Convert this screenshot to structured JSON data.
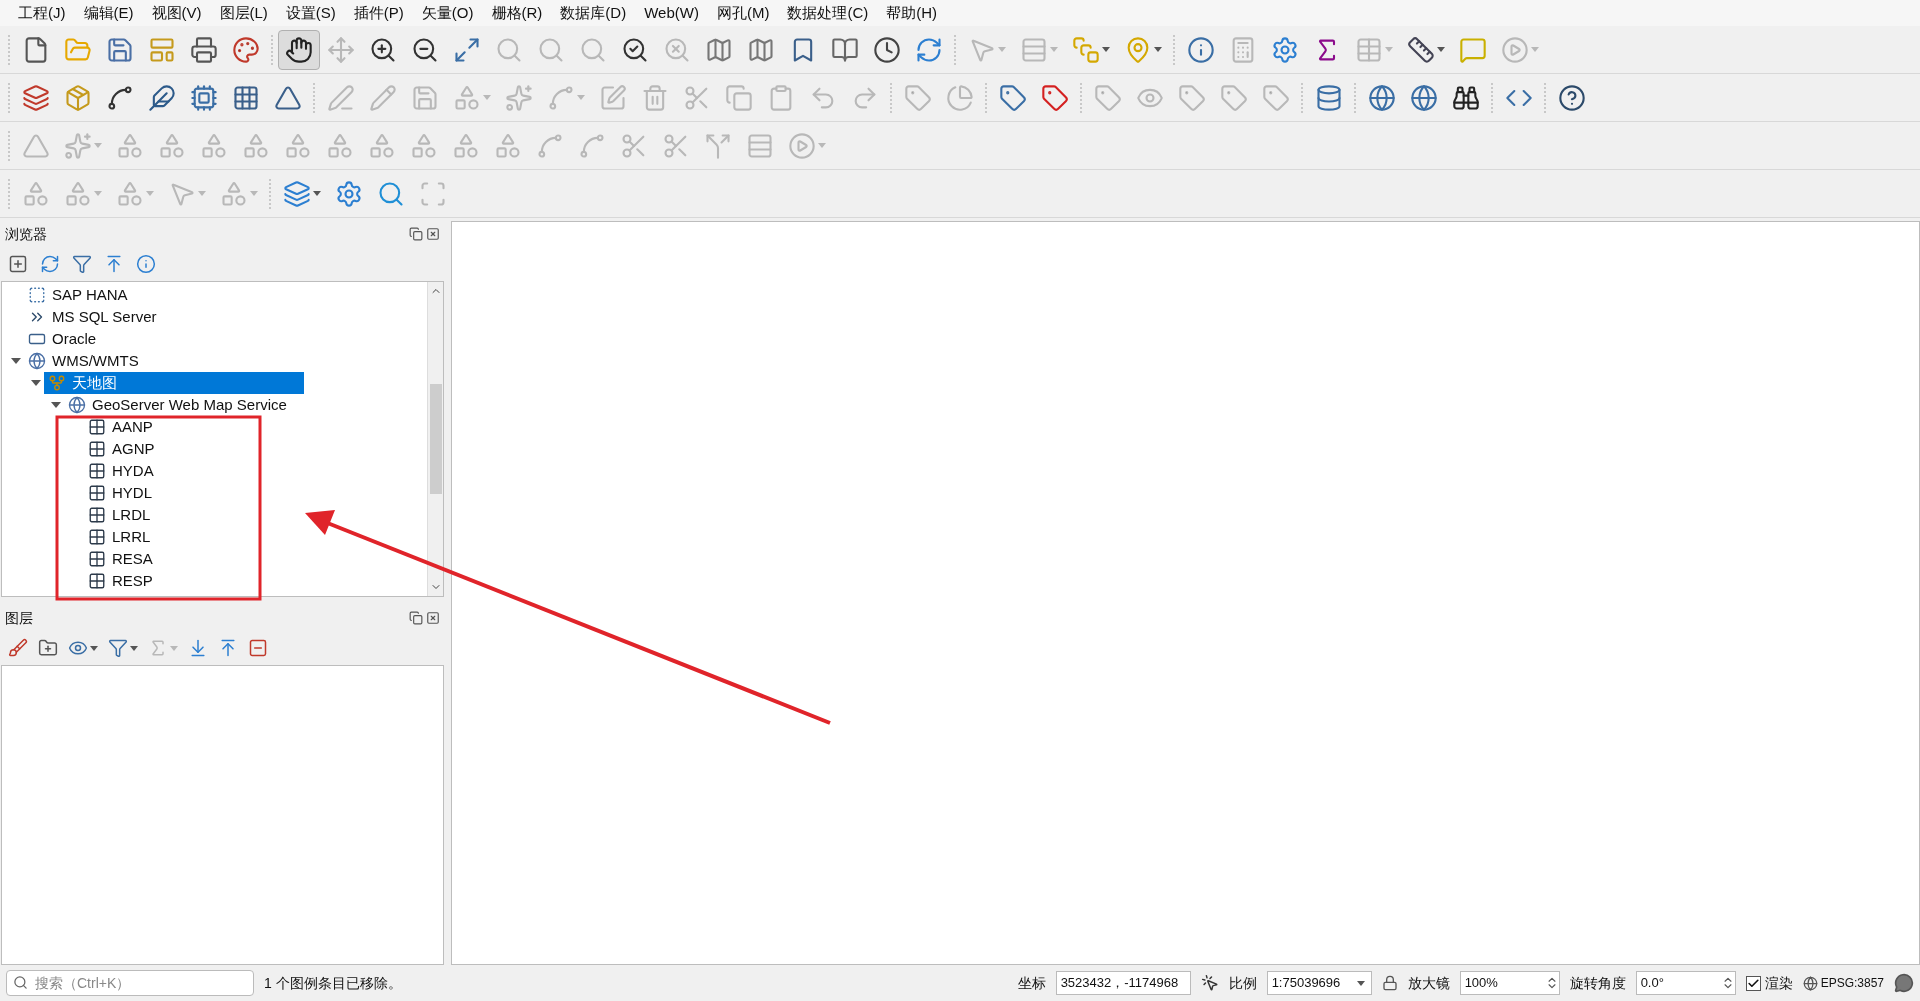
{
  "menu": [
    "工程(J)",
    "编辑(E)",
    "视图(V)",
    "图层(L)",
    "设置(S)",
    "插件(P)",
    "矢量(O)",
    "栅格(R)",
    "数据库(D)",
    "Web(W)",
    "网孔(M)",
    "数据处理(C)",
    "帮助(H)"
  ],
  "toolbars": [
    [
      {
        "kind": "new",
        "disabled": false,
        "pressed": false,
        "dropdown": false
      },
      {
        "kind": "open",
        "disabled": false,
        "pressed": false,
        "dropdown": false
      },
      {
        "kind": "save",
        "disabled": false,
        "pressed": false,
        "dropdown": false
      },
      {
        "kind": "layout",
        "disabled": false,
        "pressed": false,
        "dropdown": false
      },
      {
        "kind": "print",
        "disabled": false,
        "pressed": false,
        "dropdown": false
      },
      {
        "kind": "style",
        "disabled": false,
        "pressed": false,
        "dropdown": false
      },
      {
        "kind": "sep"
      },
      {
        "kind": "pan",
        "disabled": false,
        "pressed": true,
        "dropdown": false
      },
      {
        "kind": "move",
        "disabled": true,
        "pressed": false,
        "dropdown": false
      },
      {
        "kind": "zoom-in",
        "disabled": false,
        "pressed": false,
        "dropdown": false
      },
      {
        "kind": "zoom-out",
        "disabled": false,
        "pressed": false,
        "dropdown": false
      },
      {
        "kind": "full",
        "disabled": false,
        "pressed": false,
        "dropdown": false
      },
      {
        "kind": "search",
        "disabled": true,
        "pressed": false,
        "dropdown": false
      },
      {
        "kind": "search",
        "disabled": true,
        "pressed": false,
        "dropdown": false
      },
      {
        "kind": "search",
        "disabled": true,
        "pressed": false,
        "dropdown": false
      },
      {
        "kind": "zoom-last",
        "disabled": false,
        "pressed": false,
        "dropdown": false
      },
      {
        "kind": "zoom-next",
        "disabled": true,
        "pressed": false,
        "dropdown": false
      },
      {
        "kind": "map",
        "disabled": false,
        "pressed": false,
        "dropdown": false
      },
      {
        "kind": "map3d",
        "disabled": false,
        "pressed": false,
        "dropdown": false
      },
      {
        "kind": "bookmark",
        "disabled": false,
        "pressed": false,
        "dropdown": false
      },
      {
        "kind": "book",
        "disabled": false,
        "pressed": false,
        "dropdown": false
      },
      {
        "kind": "clock",
        "disabled": false,
        "pressed": false,
        "dropdown": false
      },
      {
        "kind": "refresh",
        "disabled": false,
        "pressed": false,
        "dropdown": false
      },
      {
        "kind": "sep"
      },
      {
        "kind": "select",
        "disabled": true,
        "pressed": false,
        "dropdown": true
      },
      {
        "kind": "rows",
        "disabled": true,
        "pressed": false,
        "dropdown": true
      },
      {
        "kind": "deselect",
        "disabled": false,
        "pressed": false,
        "dropdown": true
      },
      {
        "kind": "location",
        "disabled": false,
        "pressed": false,
        "dropdown": true
      },
      {
        "kind": "sep"
      },
      {
        "kind": "identify",
        "disabled": false,
        "pressed": false,
        "dropdown": false
      },
      {
        "kind": "calculator",
        "disabled": true,
        "pressed": false,
        "dropdown": false
      },
      {
        "kind": "gear",
        "disabled": false,
        "pressed": false,
        "dropdown": false
      },
      {
        "kind": "sigma",
        "disabled": false,
        "pressed": false,
        "dropdown": false
      },
      {
        "kind": "table",
        "disabled": true,
        "pressed": false,
        "dropdown": true
      },
      {
        "kind": "ruler",
        "disabled": false,
        "pressed": false,
        "dropdown": true
      },
      {
        "kind": "tip",
        "disabled": false,
        "pressed": false,
        "dropdown": false
      },
      {
        "kind": "action",
        "disabled": true,
        "pressed": false,
        "dropdown": true
      }
    ],
    [
      {
        "kind": "add-layer",
        "disabled": false,
        "pressed": false,
        "dropdown": false
      },
      {
        "kind": "package",
        "disabled": false,
        "pressed": false,
        "dropdown": false
      },
      {
        "kind": "spline",
        "disabled": false,
        "pressed": false,
        "dropdown": false
      },
      {
        "kind": "feather",
        "disabled": false,
        "pressed": false,
        "dropdown": false
      },
      {
        "kind": "chip",
        "disabled": false,
        "pressed": false,
        "dropdown": false
      },
      {
        "kind": "grid",
        "disabled": false,
        "pressed": false,
        "dropdown": false
      },
      {
        "kind": "virtual",
        "disabled": false,
        "pressed": false,
        "dropdown": false
      },
      {
        "kind": "sep"
      },
      {
        "kind": "pen",
        "disabled": true,
        "pressed": false,
        "dropdown": false
      },
      {
        "kind": "pencil",
        "disabled": true,
        "pressed": false,
        "dropdown": false
      },
      {
        "kind": "save",
        "disabled": true,
        "pressed": false,
        "dropdown": false
      },
      {
        "kind": "shape",
        "disabled": true,
        "pressed": false,
        "dropdown": true
      },
      {
        "kind": "points",
        "disabled": true,
        "pressed": false,
        "dropdown": false
      },
      {
        "kind": "vertex",
        "disabled": true,
        "pressed": false,
        "dropdown": true
      },
      {
        "kind": "edit-table",
        "disabled": true,
        "pressed": false,
        "dropdown": false
      },
      {
        "kind": "trash",
        "disabled": true,
        "pressed": false,
        "dropdown": false
      },
      {
        "kind": "cut",
        "disabled": true,
        "pressed": false,
        "dropdown": false
      },
      {
        "kind": "copy",
        "disabled": true,
        "pressed": false,
        "dropdown": false
      },
      {
        "kind": "paste",
        "disabled": true,
        "pressed": false,
        "dropdown": false
      },
      {
        "kind": "undo",
        "disabled": true,
        "pressed": false,
        "dropdown": false
      },
      {
        "kind": "redo",
        "disabled": true,
        "pressed": false,
        "dropdown": false
      },
      {
        "kind": "sep"
      },
      {
        "kind": "label",
        "disabled": true,
        "pressed": false,
        "dropdown": false
      },
      {
        "kind": "diagram",
        "disabled": true,
        "pressed": false,
        "dropdown": false
      },
      {
        "kind": "sep"
      },
      {
        "kind": "label-pin",
        "disabled": false,
        "pressed": false,
        "dropdown": false
      },
      {
        "kind": "label-red",
        "disabled": false,
        "pressed": false,
        "dropdown": false
      },
      {
        "kind": "sep"
      },
      {
        "kind": "label",
        "disabled": true,
        "pressed": false,
        "dropdown": false
      },
      {
        "kind": "label-eye",
        "disabled": true,
        "pressed": false,
        "dropdown": false
      },
      {
        "kind": "label",
        "disabled": true,
        "pressed": false,
        "dropdown": false
      },
      {
        "kind": "label",
        "disabled": true,
        "pressed": false,
        "dropdown": false
      },
      {
        "kind": "label",
        "disabled": true,
        "pressed": false,
        "dropdown": false
      },
      {
        "kind": "sep"
      },
      {
        "kind": "database",
        "disabled": false,
        "pressed": false,
        "dropdown": false
      },
      {
        "kind": "sep"
      },
      {
        "kind": "globe",
        "disabled": false,
        "pressed": false,
        "dropdown": false
      },
      {
        "kind": "globe",
        "disabled": false,
        "pressed": false,
        "dropdown": false
      },
      {
        "kind": "binoculars",
        "disabled": false,
        "pressed": false,
        "dropdown": false
      },
      {
        "kind": "sep"
      },
      {
        "kind": "python",
        "disabled": false,
        "pressed": false,
        "dropdown": false
      },
      {
        "kind": "sep"
      },
      {
        "kind": "help",
        "disabled": false,
        "pressed": false,
        "dropdown": false
      }
    ],
    [
      {
        "kind": "ruler-triangle",
        "disabled": true,
        "pressed": false,
        "dropdown": false
      },
      {
        "kind": "points",
        "disabled": true,
        "pressed": false,
        "dropdown": true
      },
      {
        "kind": "shape",
        "disabled": true,
        "pressed": false,
        "dropdown": false
      },
      {
        "kind": "shape",
        "disabled": true,
        "pressed": false,
        "dropdown": false
      },
      {
        "kind": "shape",
        "disabled": true,
        "pressed": false,
        "dropdown": false
      },
      {
        "kind": "shape",
        "disabled": true,
        "pressed": false,
        "dropdown": false
      },
      {
        "kind": "shape",
        "disabled": true,
        "pressed": false,
        "dropdown": false
      },
      {
        "kind": "shape",
        "disabled": true,
        "pressed": false,
        "dropdown": false
      },
      {
        "kind": "shape",
        "disabled": true,
        "pressed": false,
        "dropdown": false
      },
      {
        "kind": "shape",
        "disabled": true,
        "pressed": false,
        "dropdown": false
      },
      {
        "kind": "shape",
        "disabled": true,
        "pressed": false,
        "dropdown": false
      },
      {
        "kind": "shape",
        "disabled": true,
        "pressed": false,
        "dropdown": false
      },
      {
        "kind": "spline",
        "disabled": true,
        "pressed": false,
        "dropdown": false
      },
      {
        "kind": "vertex",
        "disabled": true,
        "pressed": false,
        "dropdown": false
      },
      {
        "kind": "cut",
        "disabled": true,
        "pressed": false,
        "dropdown": false
      },
      {
        "kind": "cut",
        "disabled": true,
        "pressed": false,
        "dropdown": false
      },
      {
        "kind": "split",
        "disabled": true,
        "pressed": false,
        "dropdown": false
      },
      {
        "kind": "rows",
        "disabled": true,
        "pressed": false,
        "dropdown": false
      },
      {
        "kind": "action",
        "disabled": true,
        "pressed": false,
        "dropdown": true
      }
    ],
    [
      {
        "kind": "shape",
        "disabled": true,
        "pressed": false,
        "dropdown": false
      },
      {
        "kind": "shape",
        "disabled": true,
        "pressed": false,
        "dropdown": true
      },
      {
        "kind": "shape",
        "disabled": true,
        "pressed": false,
        "dropdown": true
      },
      {
        "kind": "select",
        "disabled": true,
        "pressed": false,
        "dropdown": true
      },
      {
        "kind": "shape",
        "disabled": true,
        "pressed": false,
        "dropdown": true
      },
      {
        "kind": "sep"
      },
      {
        "kind": "layers",
        "disabled": false,
        "pressed": false,
        "dropdown": true
      },
      {
        "kind": "gear",
        "disabled": false,
        "pressed": false,
        "dropdown": false
      },
      {
        "kind": "search",
        "disabled": false,
        "pressed": false,
        "dropdown": false
      },
      {
        "kind": "scan",
        "disabled": true,
        "pressed": false,
        "dropdown": false
      }
    ]
  ],
  "browser": {
    "title": "浏览器",
    "tools": [
      {
        "kind": "add-square"
      },
      {
        "kind": "refresh"
      },
      {
        "kind": "filter"
      },
      {
        "kind": "collapse"
      },
      {
        "kind": "info"
      }
    ],
    "tree": [
      {
        "label": "SAP HANA",
        "kind": "sap",
        "selected": false
      },
      {
        "label": "MS SQL Server",
        "kind": "mssql",
        "selected": false
      },
      {
        "label": "Oracle",
        "kind": "oracle",
        "selected": false
      },
      {
        "label": "WMS/WMTS",
        "kind": "wms",
        "selected": false,
        "expanded": true,
        "children": [
          {
            "label": "天地图",
            "kind": "connection",
            "selected": true,
            "expanded": true,
            "children": [
              {
                "label": "GeoServer Web Map Service",
                "kind": "wms",
                "selected": false,
                "expanded": true,
                "children": [
                  {
                    "label": "AANP",
                    "kind": "layer",
                    "selected": false
                  },
                  {
                    "label": "AGNP",
                    "kind": "layer",
                    "selected": false
                  },
                  {
                    "label": "HYDA",
                    "kind": "layer",
                    "selected": false
                  },
                  {
                    "label": "HYDL",
                    "kind": "layer",
                    "selected": false
                  },
                  {
                    "label": "LRDL",
                    "kind": "layer",
                    "selected": false
                  },
                  {
                    "label": "LRRL",
                    "kind": "layer",
                    "selected": false
                  },
                  {
                    "label": "RESA",
                    "kind": "layer",
                    "selected": false
                  },
                  {
                    "label": "RESP",
                    "kind": "layer",
                    "selected": false
                  }
                ]
              }
            ]
          }
        ]
      }
    ]
  },
  "layers": {
    "title": "图层",
    "tools": [
      {
        "kind": "brush",
        "disabled": false,
        "dropdown": false
      },
      {
        "kind": "add-group",
        "disabled": false,
        "dropdown": false
      },
      {
        "kind": "eye",
        "disabled": false,
        "dropdown": true
      },
      {
        "kind": "filter",
        "disabled": false,
        "dropdown": true
      },
      {
        "kind": "expression",
        "disabled": true,
        "dropdown": true
      },
      {
        "kind": "expand",
        "disabled": false,
        "dropdown": false
      },
      {
        "kind": "collapse",
        "disabled": false,
        "dropdown": false
      },
      {
        "kind": "remove",
        "disabled": false,
        "dropdown": false
      }
    ]
  },
  "status_bar": {
    "search": {
      "placeholder": "搜索（Ctrl+K）"
    },
    "message": "1 个图例条目已移除。",
    "coordinate_label": "坐标",
    "coordinate": "3523432，-1174968",
    "scale_label": "比例",
    "scale": "1:75039696",
    "magnifier_label": "放大镜",
    "magnifier": "100%",
    "rotation_label": "旋转角度",
    "rotation": "0.0°",
    "render_label": "渲染",
    "render": true,
    "crs": "EPSG:3857"
  },
  "annotation": {
    "kind": "highlight-with-arrow"
  }
}
